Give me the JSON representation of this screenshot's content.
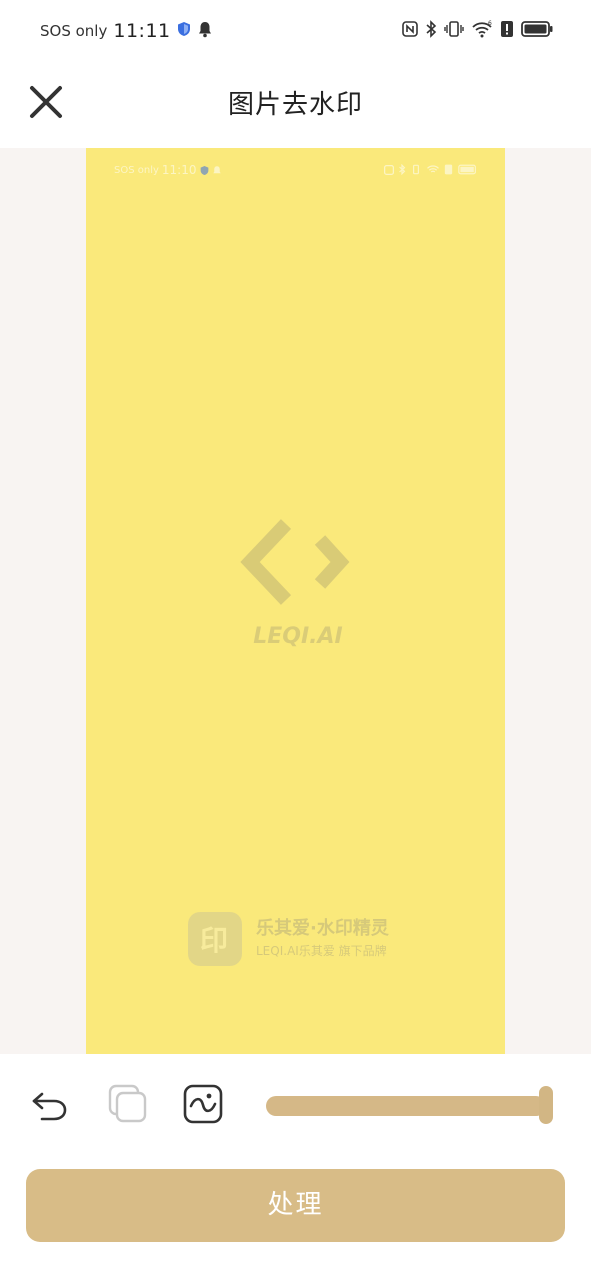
{
  "status_bar": {
    "carrier": "SOS only",
    "time": "11:11",
    "icons": [
      "shield-icon",
      "bell-icon",
      "nfc-icon",
      "bluetooth-icon",
      "vibrate-icon",
      "wifi-icon",
      "alert-icon",
      "battery-icon"
    ]
  },
  "header": {
    "close_icon": "close-icon",
    "title": "图片去水印"
  },
  "preview": {
    "background": "#fae97b",
    "mini_status": {
      "carrier": "SOS only",
      "time": "11:10"
    },
    "watermark_center": "LEQI.AI",
    "watermark_bottom": {
      "name": "乐其爱·水印精灵",
      "subtitle": "LEQI.AI乐其爱 旗下品牌"
    }
  },
  "toolbar": {
    "undo_icon": "undo-icon",
    "layers_icon": "layers-icon",
    "image_edit_icon": "image-edit-icon",
    "brush_size_fraction": 1.0
  },
  "actions": {
    "process_label": "处理"
  },
  "colors": {
    "accent": "#d8bc87",
    "canvas_bg": "#f8f4f2",
    "preview_bg": "#fae97b"
  }
}
